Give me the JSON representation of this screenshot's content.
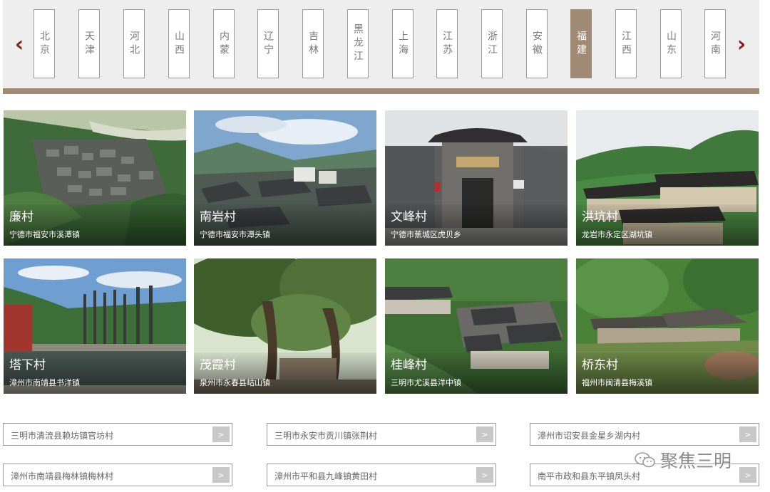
{
  "nav": {
    "prev_label": "‹",
    "next_label": "›",
    "provinces": [
      "北京",
      "天津",
      "河北",
      "山西",
      "内蒙",
      "辽宁",
      "吉林",
      "黑龙江",
      "上海",
      "江苏",
      "浙江",
      "安徽",
      "福建",
      "江西",
      "山东",
      "河南"
    ],
    "active": "福建",
    "active_color": "#a08a74",
    "arrow_color": "#8b1c16"
  },
  "villages": [
    {
      "name": "廉村",
      "location": "宁德市福安市溪潭镇",
      "scene": "aerial-village"
    },
    {
      "name": "南岩村",
      "location": "宁德市福安市潭头镇",
      "scene": "mountain-village"
    },
    {
      "name": "文峰村",
      "location": "宁德市蕉城区虎贝乡",
      "scene": "stone-gate"
    },
    {
      "name": "洪坑村",
      "location": "龙岩市永定区湖坑镇",
      "scene": "tulou-hill"
    },
    {
      "name": "塔下村",
      "location": "漳州市南靖县书洋镇",
      "scene": "pillars-pond"
    },
    {
      "name": "茂霞村",
      "location": "泉州市永春县岵山镇",
      "scene": "banyan-trees"
    },
    {
      "name": "桂峰村",
      "location": "三明市尤溪县洋中镇",
      "scene": "hillside-houses"
    },
    {
      "name": "桥东村",
      "location": "福州市闽清县梅溪镇",
      "scene": "forest-roof"
    }
  ],
  "links": [
    "三明市清流县赖坊镇官坊村",
    "三明市永安市贡川镇张荆村",
    "漳州市诏安县金星乡湖内村",
    "漳州市南靖县梅林镇梅林村",
    "漳州市平和县九峰镇黄田村",
    "南平市政和县东平镇凤头村"
  ],
  "link_go_label": ">",
  "watermark": "聚焦三明",
  "watermark_icon": "wechat-icon"
}
